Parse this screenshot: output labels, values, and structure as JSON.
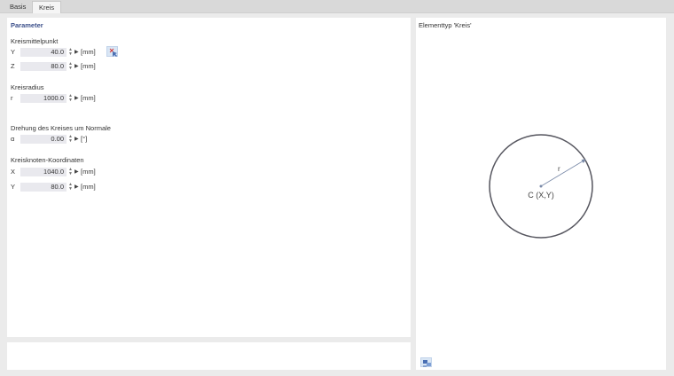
{
  "tabs": [
    {
      "label": "Basis"
    },
    {
      "label": "Kreis"
    }
  ],
  "parameters": {
    "title": "Parameter",
    "center": {
      "label": "Kreismittelpunkt",
      "y": {
        "symbol": "Y",
        "value": "40.0",
        "unit": "[mm]"
      },
      "z": {
        "symbol": "Z",
        "value": "80.0",
        "unit": "[mm]"
      }
    },
    "radius": {
      "label": "Kreisradius",
      "r": {
        "symbol": "r",
        "value": "1000.0",
        "unit": "[mm]"
      }
    },
    "rotation": {
      "label": "Drehung des Kreises um Normale",
      "alpha": {
        "symbol": "α",
        "value": "0.00",
        "unit": "[°]"
      }
    },
    "node": {
      "label": "Kreisknoten-Koordinaten",
      "x": {
        "symbol": "X",
        "value": "1040.0",
        "unit": "[mm]"
      },
      "y": {
        "symbol": "Y",
        "value": "80.0",
        "unit": "[mm]"
      }
    }
  },
  "preview": {
    "title": "Elementtyp 'Kreis'",
    "radius_label": "r",
    "center_label": "C (X,Y)"
  },
  "icons": {
    "spinner": "spinner-icon",
    "expand": "play-arrow-icon",
    "pick": "pick-point-icon",
    "view": "view-options-icon"
  },
  "colors": {
    "section_title": "#3b4f8a",
    "field_bg": "#e9e9ee",
    "circle_stroke": "#55555e",
    "radius_arrow": "#7a8aa8",
    "button_bg": "#d9e6f5"
  }
}
